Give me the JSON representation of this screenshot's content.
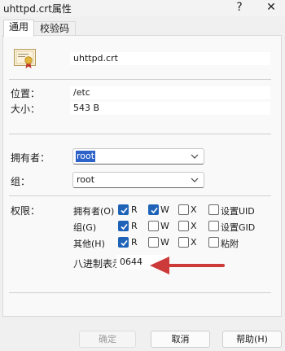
{
  "window": {
    "title": "uhttpd.crt属性",
    "help_glyph": "?",
    "close_glyph": "✕"
  },
  "tabs": [
    {
      "label": "通用"
    },
    {
      "label": "校验码"
    }
  ],
  "file": {
    "name": "uhttpd.crt",
    "icon": "certificate-icon"
  },
  "info": {
    "location_label": "位置：",
    "location_value": "/etc",
    "size_label": "大小：",
    "size_value": "543 B"
  },
  "ownership": {
    "owner_label": "拥有者：",
    "owner_value": "root",
    "group_label": "组：",
    "group_value": "root"
  },
  "permissions": {
    "label": "权限：",
    "rows": [
      {
        "label": "拥有者(O)",
        "r": true,
        "w": true,
        "x": false,
        "extra_label": "设置UID",
        "extra": false
      },
      {
        "label": "组(G)",
        "r": true,
        "w": false,
        "x": false,
        "extra_label": "设置GID",
        "extra": false
      },
      {
        "label": "其他(H)",
        "r": true,
        "w": false,
        "x": false,
        "extra_label": "粘附",
        "extra": false
      }
    ],
    "r_label": "R",
    "w_label": "W",
    "x_label": "X",
    "octal_label": "八进制表示",
    "octal_value": "0644"
  },
  "buttons": {
    "ok": "确定",
    "cancel": "取消",
    "help": "帮助(H)"
  },
  "colors": {
    "accent": "#1f63b8",
    "selection": "#2c62c9",
    "arrow": "#cc3a3a"
  }
}
